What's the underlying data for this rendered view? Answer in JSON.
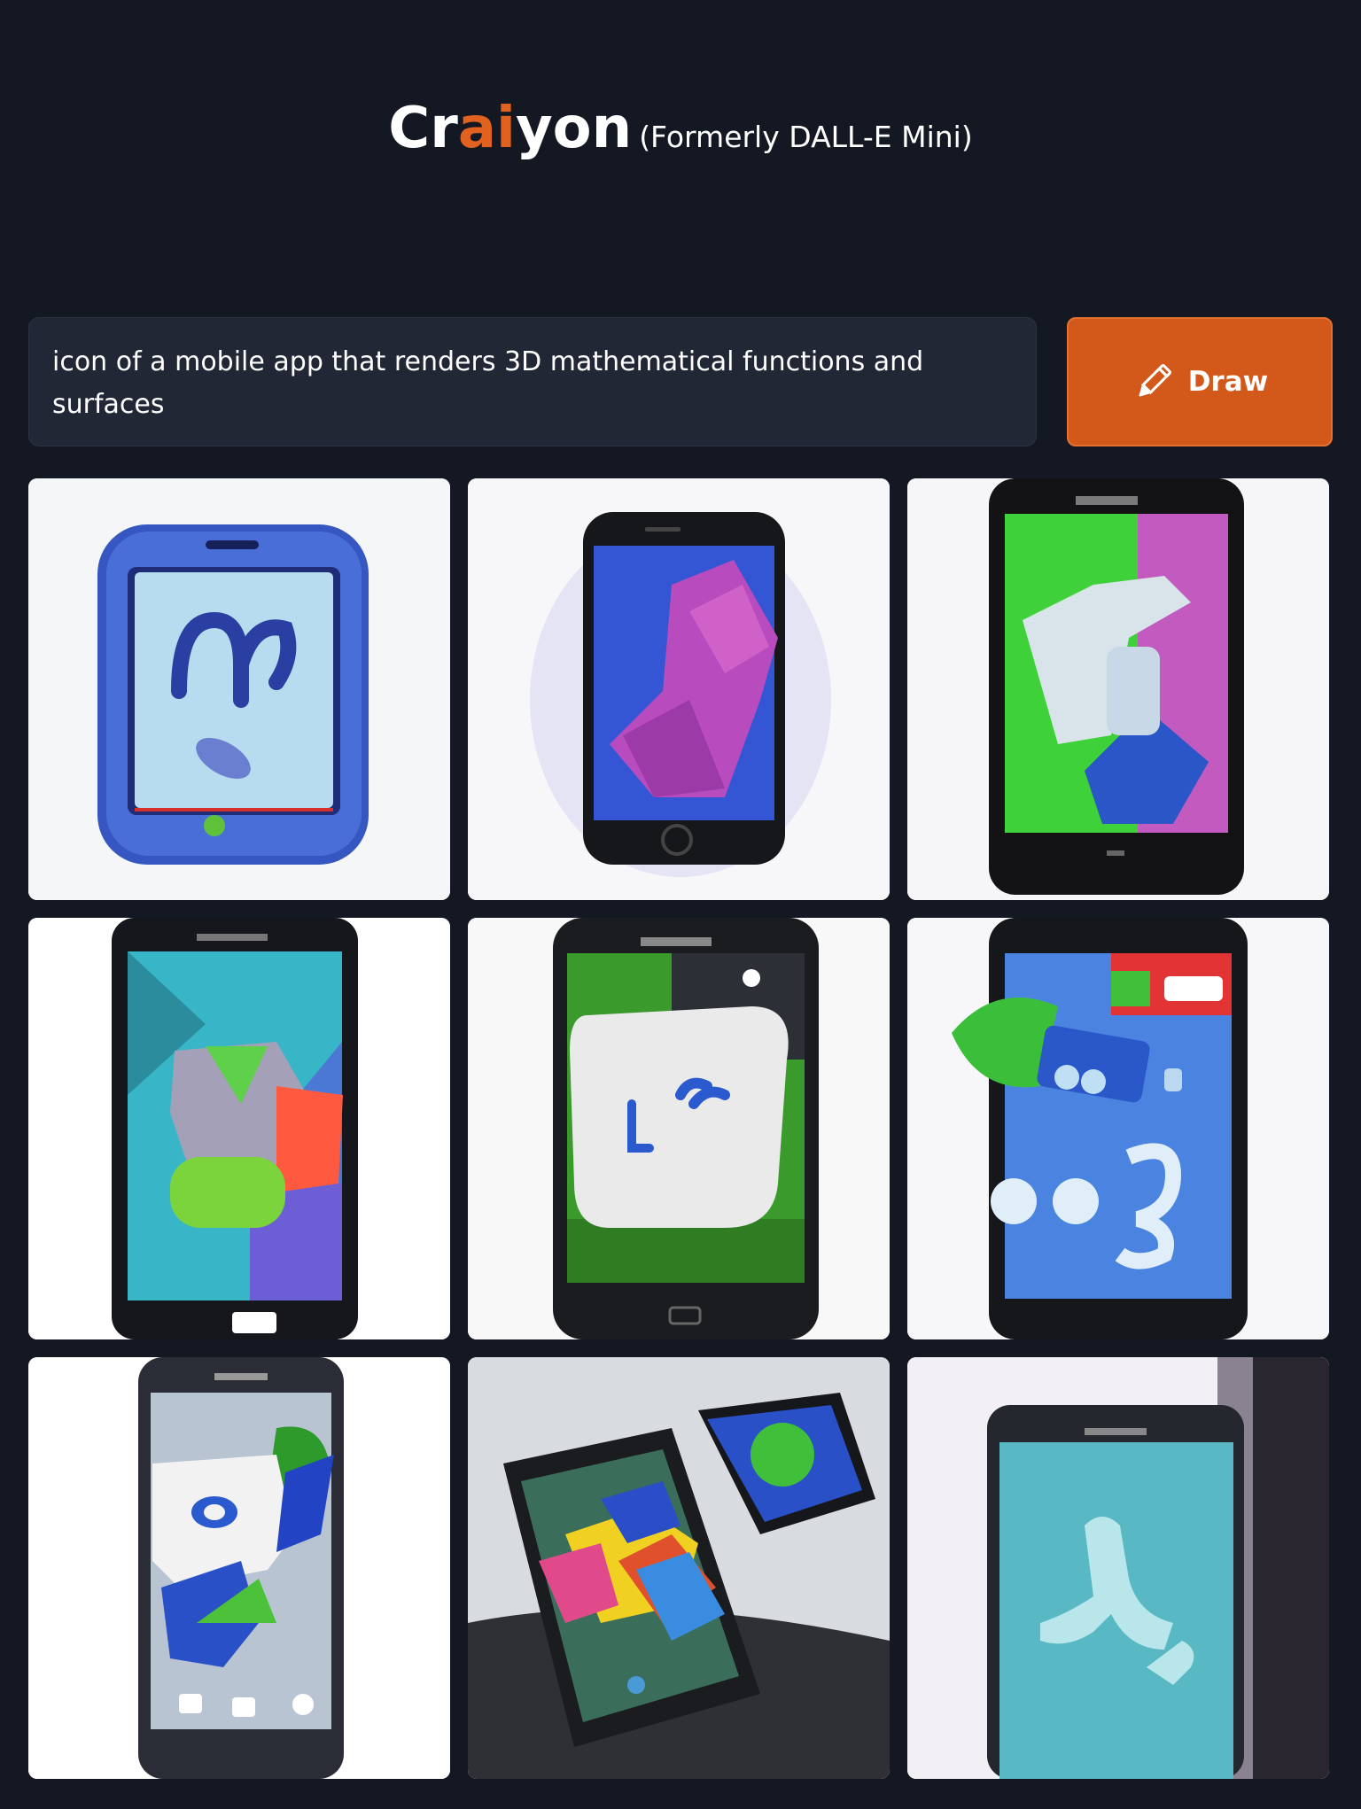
{
  "header": {
    "brand_prefix": "Cr",
    "brand_accent": "ai",
    "brand_suffix": "yon",
    "subtitle": "(Formerly DALL-E Mini)"
  },
  "prompt": {
    "text": "icon of a mobile app that renders 3D mathematical functions and surfaces"
  },
  "draw_button": {
    "label": "Draw",
    "icon": "pencil-icon"
  },
  "colors": {
    "background": "#141822",
    "accent": "#e0621e",
    "button": "#d2591a",
    "input_background": "#222736"
  },
  "results": {
    "count": 9,
    "images": [
      {
        "subject": "blue-tablet-icon"
      },
      {
        "subject": "phone-magenta-shape"
      },
      {
        "subject": "phone-green-pink-white-shape"
      },
      {
        "subject": "phone-teal-blocks"
      },
      {
        "subject": "phone-white-tile"
      },
      {
        "subject": "phone-blue-symbols"
      },
      {
        "subject": "phone-white-blue-shape"
      },
      {
        "subject": "tilted-phones-colorful-shape"
      },
      {
        "subject": "phone-teal-screen"
      }
    ]
  }
}
